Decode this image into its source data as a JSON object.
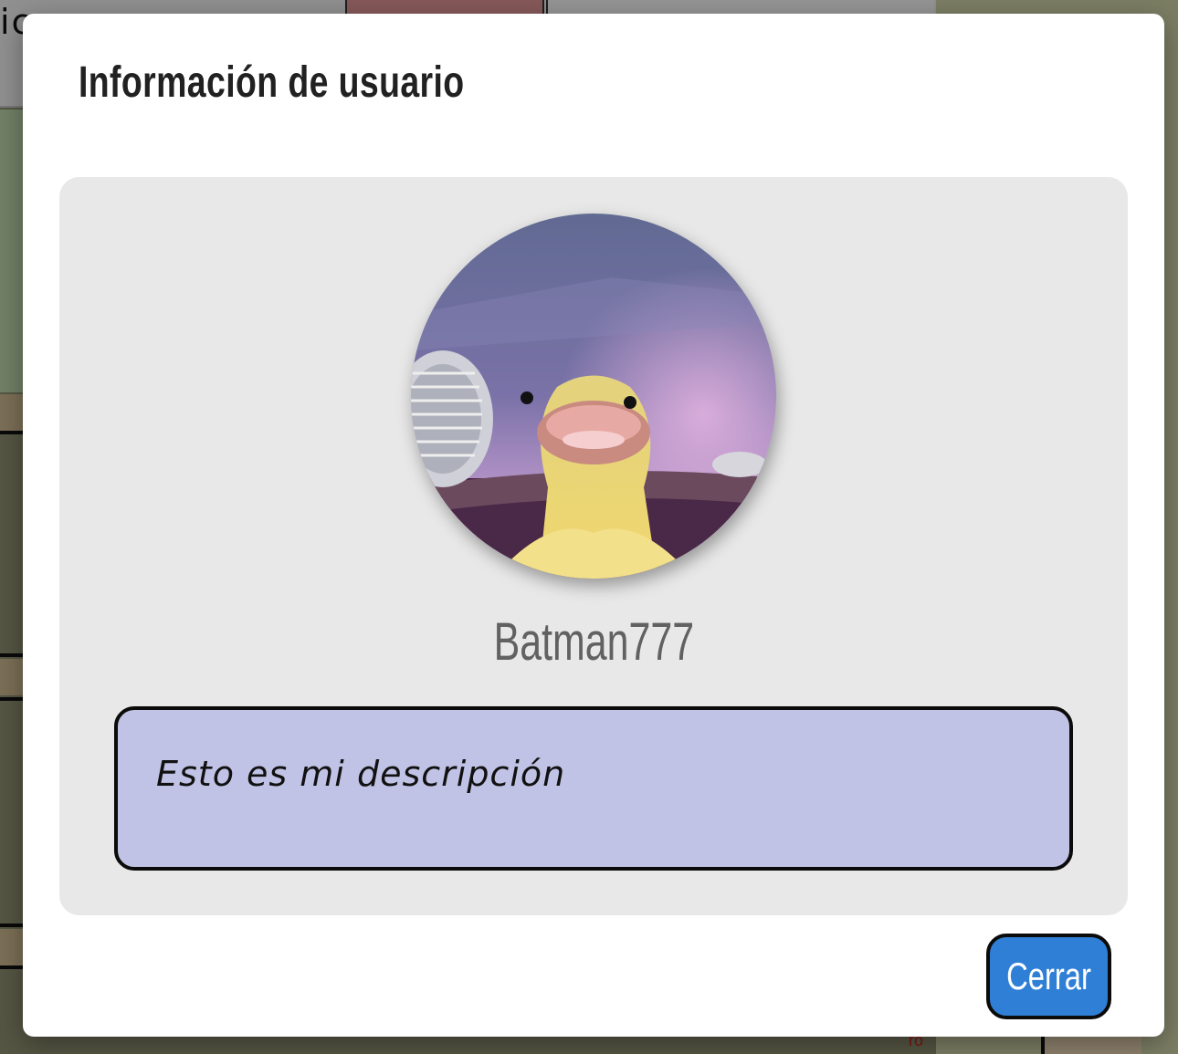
{
  "background": {
    "nav_text": "ic",
    "marks": [
      "ro"
    ]
  },
  "modal": {
    "title": "Información de usuario",
    "avatar_icon": "duckling-photo",
    "username": "Batman777",
    "description": "Esto es mi descripción",
    "close_label": "Cerrar"
  },
  "colors": {
    "card_bg": "#e8e8e8",
    "description_bg": "#c1c3e6",
    "button_bg": "#2f7fd6",
    "username_text": "#616161"
  }
}
